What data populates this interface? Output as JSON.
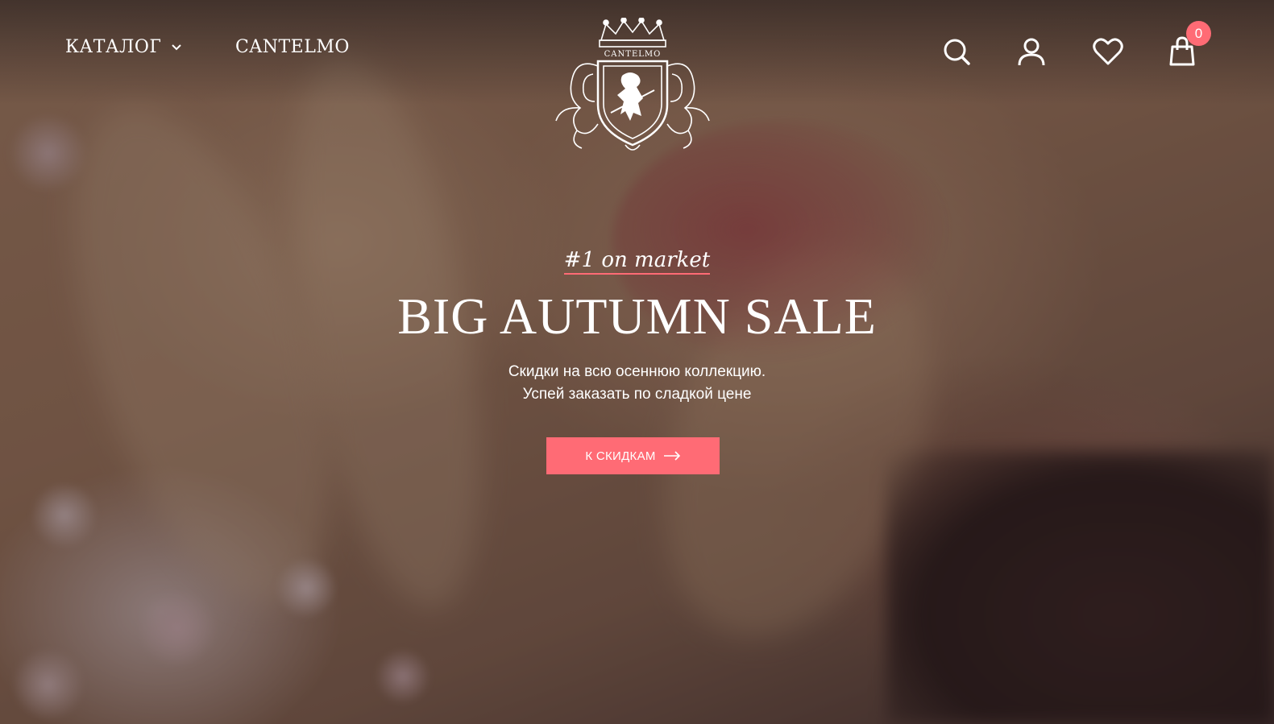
{
  "header": {
    "nav_catalog_label": "КАТАЛОГ",
    "nav_brand_label": "CANTELMO",
    "logo_text": "CANTELMO",
    "icons": [
      "search-icon",
      "user-icon",
      "heart-icon",
      "cart-icon"
    ],
    "cart_count": "0"
  },
  "hero": {
    "tagline": "#1 on market",
    "headline": "BIG AUTUMN SALE",
    "subtext_line1": "Скидки на всю осеннюю коллекцию.",
    "subtext_line2": "Успей заказать по сладкой цене",
    "cta_label": "К СКИДКАМ"
  },
  "colors": {
    "accent": "#ff6b75",
    "text": "#ffffff"
  }
}
